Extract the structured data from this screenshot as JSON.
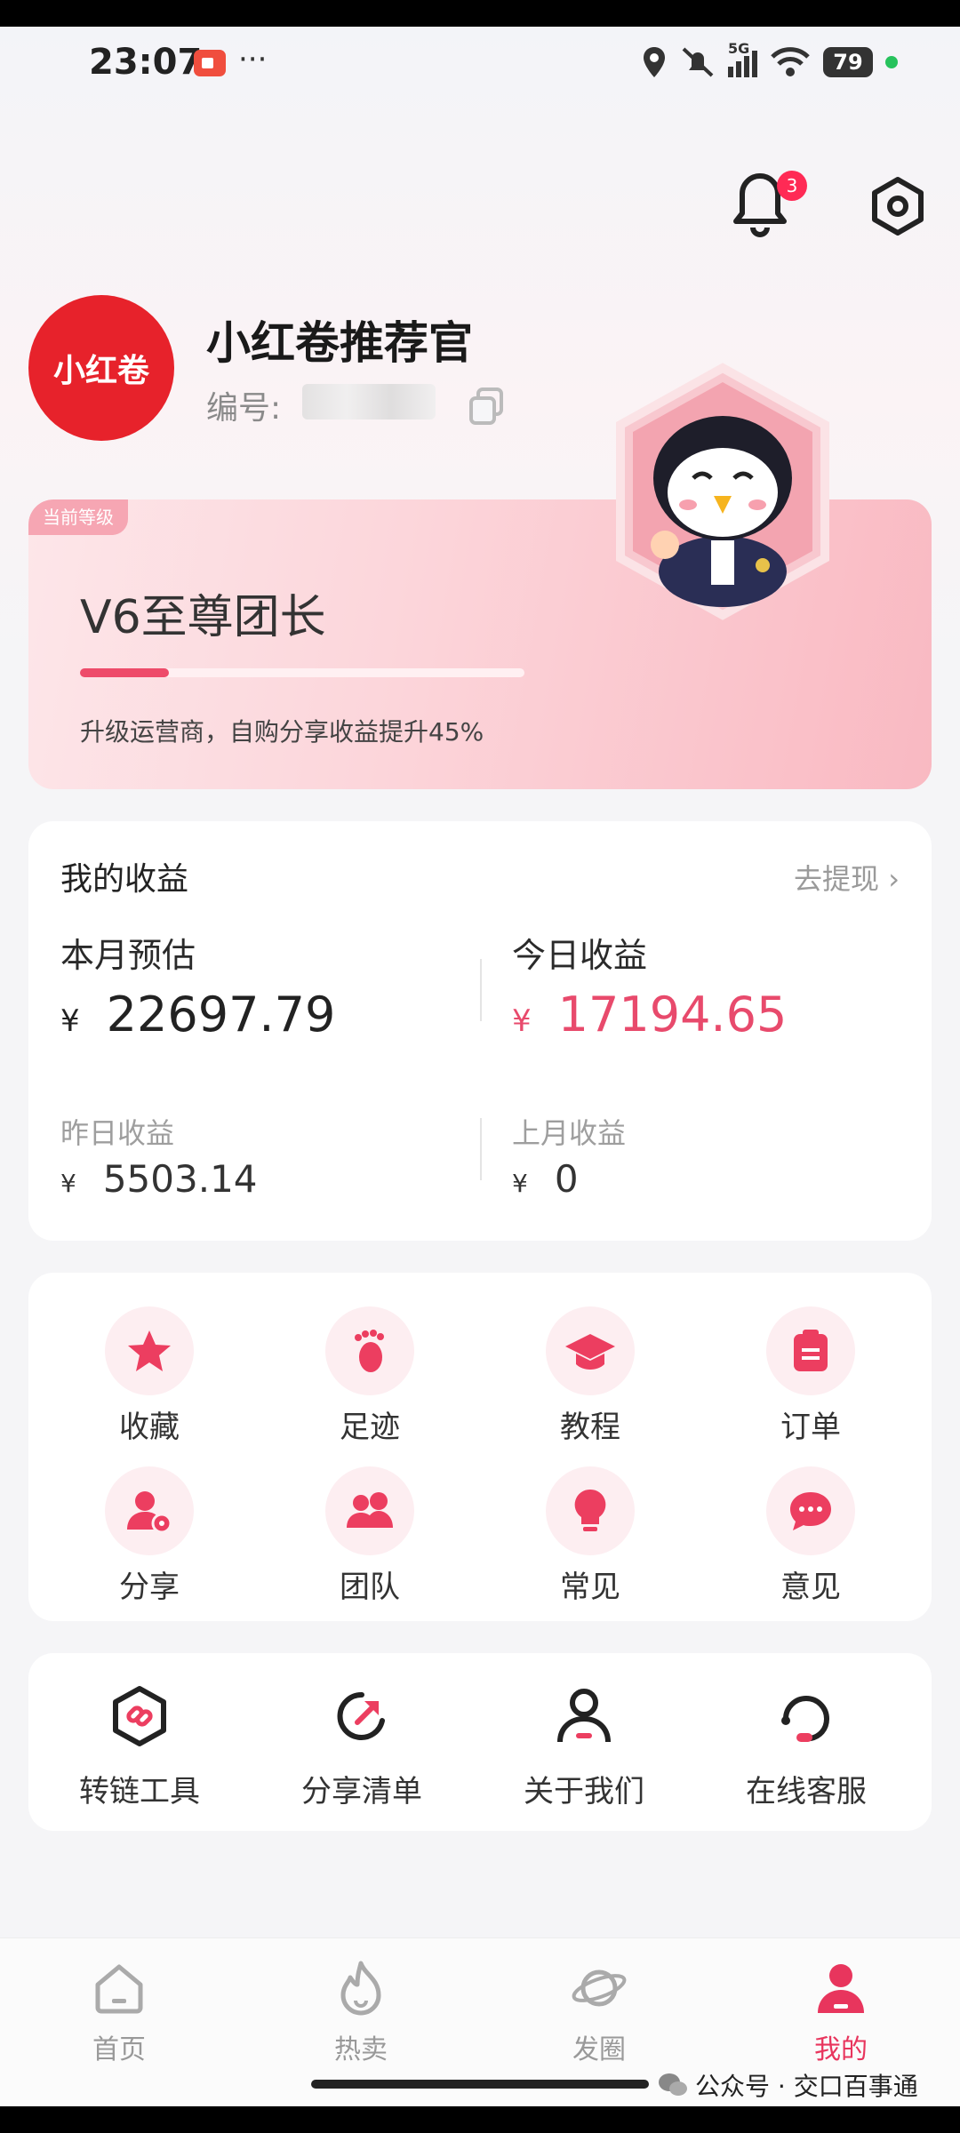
{
  "status_bar": {
    "time": "23:07",
    "dots": "···",
    "network": "5G",
    "battery": "79"
  },
  "header": {
    "notification_count": "3"
  },
  "profile": {
    "name": "小红卷推荐官",
    "id_label": "编号:",
    "avatar_text": "小红卷"
  },
  "level": {
    "tag": "当前等级",
    "name": "V6至尊团长",
    "progress": 0.2,
    "description": "升级运营商，自购分享收益提升45%"
  },
  "earnings": {
    "title": "我的收益",
    "withdraw": "去提现 ›",
    "currency": "¥",
    "month_estimate_label": "本月预估",
    "month_estimate_value": "22697.79",
    "today_label": "今日收益",
    "today_value": "17194.65",
    "yesterday_label": "昨日收益",
    "yesterday_value": "5503.14",
    "last_month_label": "上月收益",
    "last_month_value": "0"
  },
  "grid": {
    "items": [
      {
        "label": "收藏",
        "icon": "star-icon"
      },
      {
        "label": "足迹",
        "icon": "footprint-icon"
      },
      {
        "label": "教程",
        "icon": "graduation-cap-icon"
      },
      {
        "label": "订单",
        "icon": "order-icon"
      },
      {
        "label": "分享",
        "icon": "share-user-icon"
      },
      {
        "label": "团队",
        "icon": "team-icon"
      },
      {
        "label": "常见",
        "icon": "lightbulb-icon"
      },
      {
        "label": "意见",
        "icon": "chat-bubble-icon"
      }
    ]
  },
  "tools": {
    "items": [
      {
        "label": "转链工具",
        "icon": "link-icon"
      },
      {
        "label": "分享清单",
        "icon": "share-list-icon"
      },
      {
        "label": "关于我们",
        "icon": "user-icon"
      },
      {
        "label": "在线客服",
        "icon": "headset-icon"
      }
    ]
  },
  "tabbar": {
    "items": [
      {
        "label": "首页",
        "icon": "home-icon"
      },
      {
        "label": "热卖",
        "icon": "flame-icon"
      },
      {
        "label": "发圈",
        "icon": "planet-icon"
      },
      {
        "label": "我的",
        "icon": "profile-icon"
      }
    ],
    "active": "我的"
  },
  "watermark": "公众号 · 交口百事通",
  "colors": {
    "accent": "#e8355d",
    "brand_red": "#e7222b",
    "earning_red": "#e84a6c"
  }
}
